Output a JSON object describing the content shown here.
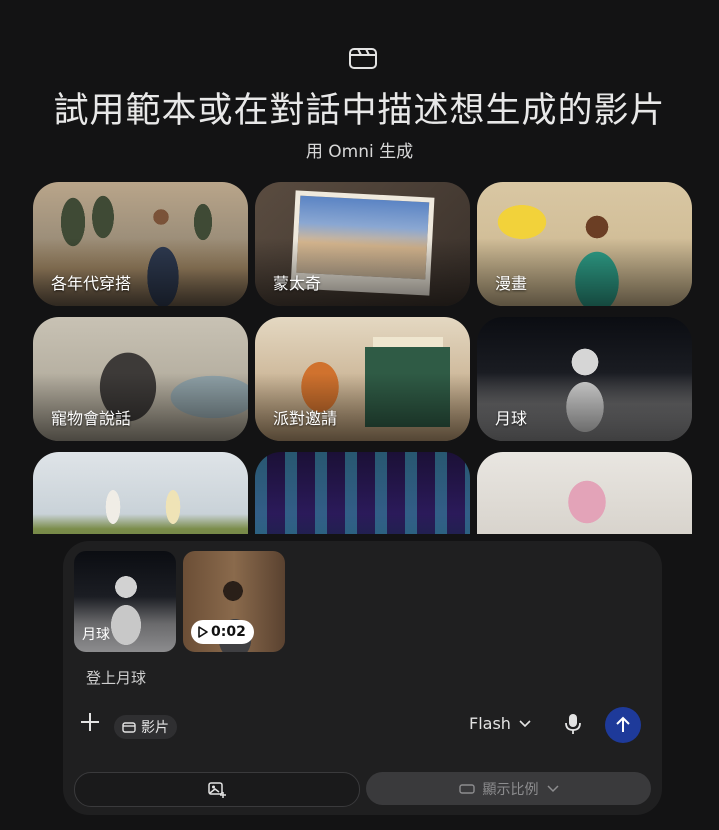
{
  "header": {
    "icon": "clapperboard-icon",
    "title": "試用範本或在對話中描述想生成的影片",
    "subtitle": "用 Omni 生成"
  },
  "templates": [
    {
      "label": "各年代穿搭"
    },
    {
      "label": "蒙太奇"
    },
    {
      "label": "漫畫"
    },
    {
      "label": "寵物會說話"
    },
    {
      "label": "派對邀請"
    },
    {
      "label": "月球"
    },
    {
      "label": ""
    },
    {
      "label": ""
    },
    {
      "label": ""
    }
  ],
  "composer": {
    "attachments": [
      {
        "type": "image",
        "label": "月球"
      },
      {
        "type": "video",
        "duration": "0:02"
      }
    ],
    "prompt_text": "登上月球",
    "mode_chip": "影片",
    "model": "Flash",
    "aspect_ratio_label": "顯示比例",
    "send_color": "#1e3a9a"
  }
}
